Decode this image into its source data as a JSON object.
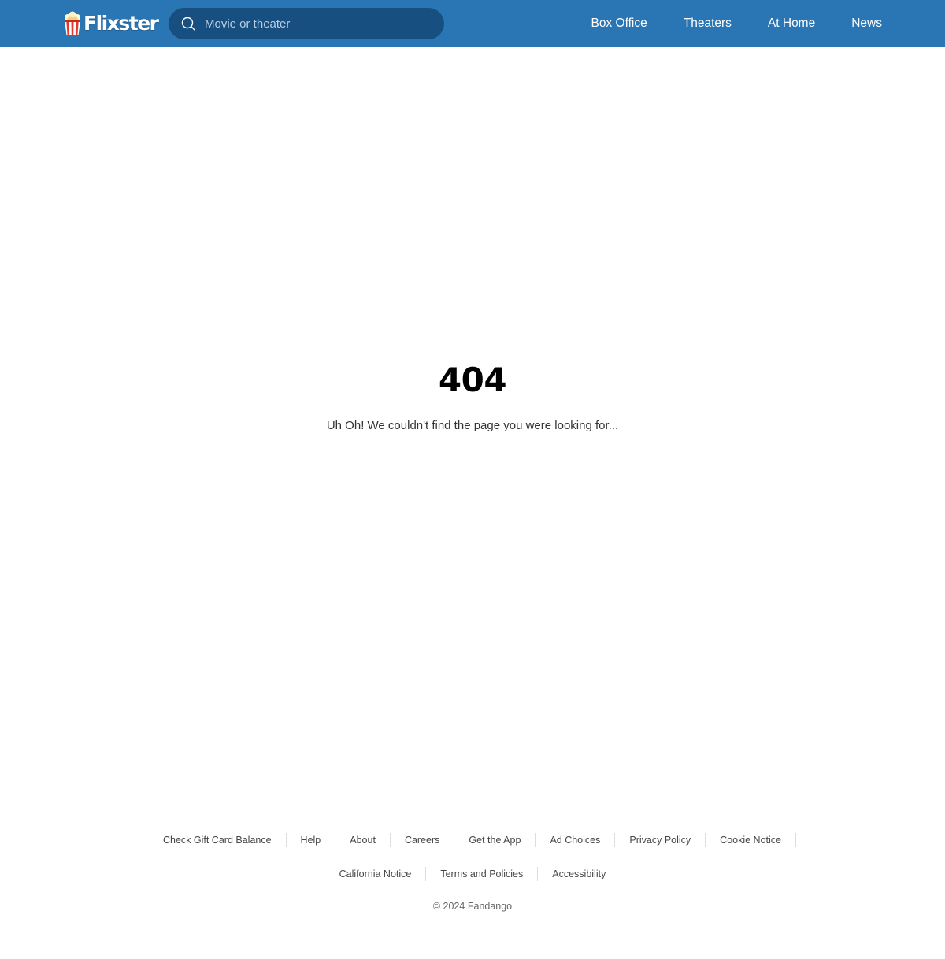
{
  "header": {
    "logo_text": "Flixster",
    "search": {
      "placeholder": "Movie or theater",
      "value": ""
    },
    "nav": [
      {
        "label": "Box Office"
      },
      {
        "label": "Theaters"
      },
      {
        "label": "At Home"
      },
      {
        "label": "News"
      }
    ]
  },
  "main": {
    "error_code": "404",
    "message": "Uh Oh! We couldn't find the page you were looking for..."
  },
  "footer": {
    "links_row1": [
      {
        "label": "Check Gift Card Balance"
      },
      {
        "label": "Help"
      },
      {
        "label": "About"
      },
      {
        "label": "Careers"
      },
      {
        "label": "Get the App"
      },
      {
        "label": "Ad Choices"
      },
      {
        "label": "Privacy Policy"
      },
      {
        "label": "Cookie Notice"
      }
    ],
    "links_row2": [
      {
        "label": "California Notice"
      },
      {
        "label": "Terms and Policies"
      },
      {
        "label": "Accessibility"
      }
    ],
    "copyright": "© 2024 Fandango"
  },
  "colors": {
    "header_bg": "#2a75b3",
    "search_bg": "#164f80"
  },
  "icons": {
    "logo": "popcorn-icon",
    "search": "search-icon"
  }
}
